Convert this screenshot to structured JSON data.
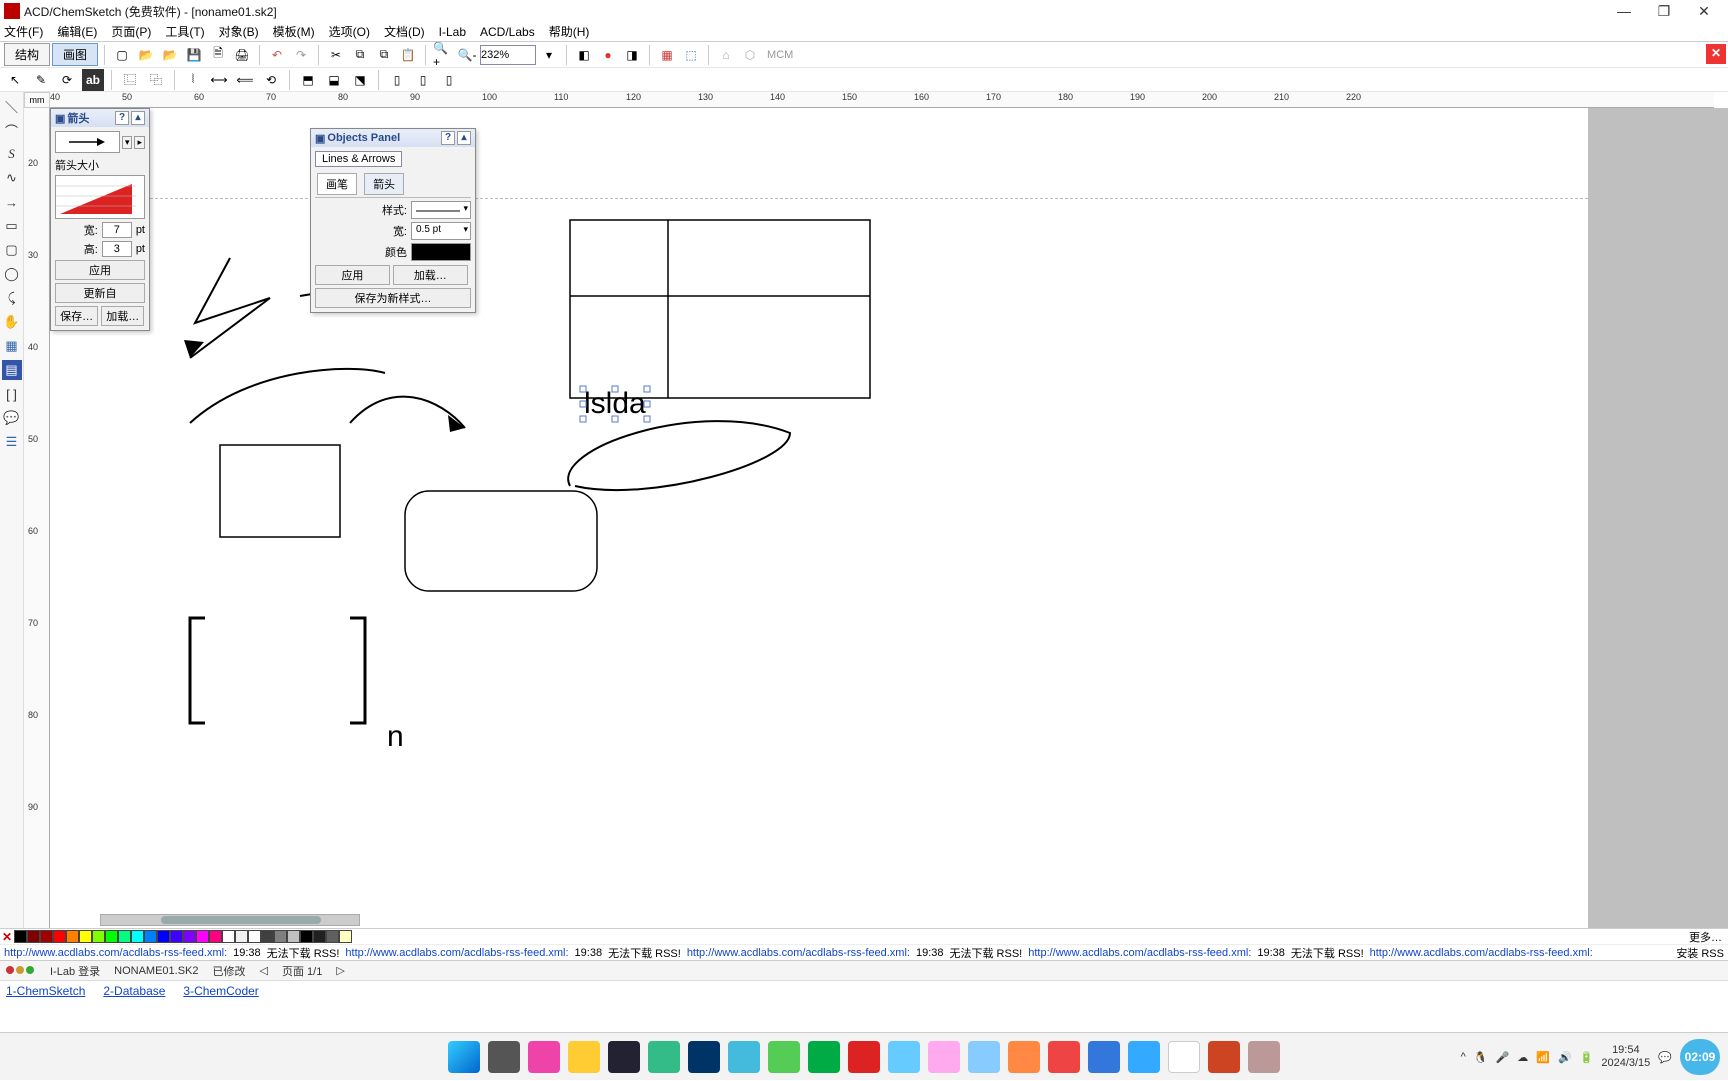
{
  "window": {
    "title": "ACD/ChemSketch (免费软件) - [noname01.sk2]",
    "minimize": "—",
    "maximize": "❐",
    "close": "✕"
  },
  "menu": [
    "文件(F)",
    "编辑(E)",
    "页面(P)",
    "工具(T)",
    "对象(B)",
    "模板(M)",
    "选项(O)",
    "文档(D)",
    "I-Lab",
    "ACD/Labs",
    "帮助(H)"
  ],
  "mode_tabs": {
    "structure": "结构",
    "draw": "画图"
  },
  "zoom": "232%",
  "toolbar_right_text": "MCM",
  "ruler_unit": "mm",
  "ruler_h": [
    "40",
    "50",
    "60",
    "70",
    "80",
    "90",
    "100",
    "110",
    "120",
    "130",
    "140",
    "150",
    "160",
    "170",
    "180",
    "190",
    "200",
    "210",
    "220"
  ],
  "ruler_v": [
    "20",
    "30",
    "40",
    "50",
    "60",
    "70",
    "80",
    "90"
  ],
  "arrow_panel": {
    "title": "箭头",
    "size_label": "箭头大小",
    "width_label": "宽:",
    "width_val": "7",
    "height_label": "高:",
    "height_val": "3",
    "unit": "pt",
    "apply": "应用",
    "update": "更新自",
    "save": "保存…",
    "load": "加载…"
  },
  "objects_panel": {
    "title": "Objects Panel",
    "lines_btn": "Lines & Arrows",
    "tab_pen": "画笔",
    "tab_arrow": "箭头",
    "style_label": "样式:",
    "width_label": "宽:",
    "width_val": "0.5 pt",
    "color_label": "颜色",
    "apply": "应用",
    "load": "加载…",
    "save_as": "保存为新样式…"
  },
  "canvas": {
    "selected_text": "lslda",
    "bracket_n": "n"
  },
  "colors": [
    "#000000",
    "#7f0000",
    "#a00000",
    "#ff0000",
    "#ff8000",
    "#ffff00",
    "#80ff00",
    "#00ff00",
    "#00ff80",
    "#00ffff",
    "#0080ff",
    "#0000ff",
    "#4000ff",
    "#8000ff",
    "#ff00ff",
    "#ff0080",
    "#ffffff",
    "#f0f0f0",
    "#ffffff",
    "#404040",
    "#808080",
    "#c0c0c0",
    "#000000",
    "#202020",
    "#606060",
    "#ffffc0"
  ],
  "more_colors": "更多…",
  "rss": {
    "url": "http://www.acdlabs.com/acdlabs-rss-feed.xml:",
    "time": "19:38",
    "err": "无法下载 RSS!",
    "install": "安装 RSS"
  },
  "status": {
    "ilab": "I-Lab 登录",
    "doc": "NONAME01.SK2",
    "modified": "已修改",
    "page": "页面 1/1"
  },
  "modes": [
    "1-ChemSketch",
    "2-Database",
    "3-ChemCoder"
  ],
  "tray": {
    "time": "19:54",
    "date": "2024/3/15",
    "pill": "02:09"
  }
}
